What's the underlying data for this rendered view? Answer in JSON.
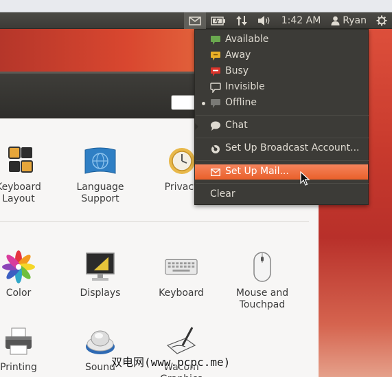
{
  "panel": {
    "clock": "1:42 AM",
    "user": "Ryan"
  },
  "messaging_menu": {
    "status_items": [
      {
        "label": "Available",
        "icon": "available-status-icon",
        "color": "#6aa84f",
        "selected": false
      },
      {
        "label": "Away",
        "icon": "away-status-icon",
        "color": "#e9b028",
        "selected": false
      },
      {
        "label": "Busy",
        "icon": "busy-status-icon",
        "color": "#d9342b",
        "selected": false
      },
      {
        "label": "Invisible",
        "icon": "invisible-status-icon",
        "color": "#dfdbd2",
        "selected": false
      },
      {
        "label": "Offline",
        "icon": "offline-status-icon",
        "color": "#8a8a86",
        "selected": true
      }
    ],
    "chat": "Chat",
    "broadcast": "Set Up Broadcast Account...",
    "mail": "Set Up Mail...",
    "clear": "Clear"
  },
  "settings": {
    "tiles": [
      {
        "label": "Keyboard\nLayout"
      },
      {
        "label": "Language\nSupport"
      },
      {
        "label": "Privacy"
      },
      {
        "label": "Color"
      },
      {
        "label": "Displays"
      },
      {
        "label": "Keyboard"
      },
      {
        "label": "Mouse and\nTouchpad"
      },
      {
        "label": "Printing"
      },
      {
        "label": "Sound"
      },
      {
        "label": "Wacom\nGraphics"
      }
    ]
  },
  "watermark": "双电网(www.pcpc.me)",
  "colors": {
    "panel": "#3c3b37",
    "menu_highlight": "#f07746",
    "header": "#d9472f"
  }
}
